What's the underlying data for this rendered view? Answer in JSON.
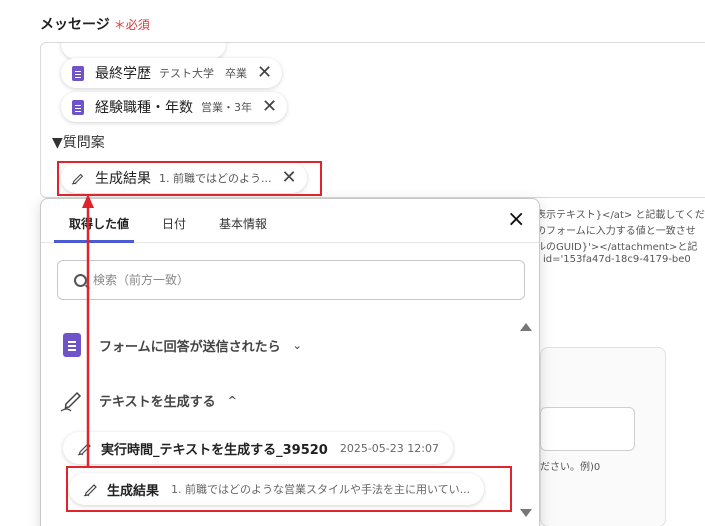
{
  "field": {
    "label": "メッセージ",
    "required_mark": "＊",
    "required_text": "必須"
  },
  "editor": {
    "chips": [
      {
        "name": "最終学歴",
        "value": "テスト大学　卒業"
      },
      {
        "name": "経験職種・年数",
        "value": "営業・3年"
      }
    ],
    "section_label": "▼質問案",
    "result_chip": {
      "name": "生成結果",
      "value": "1. 前職ではどのよう..."
    }
  },
  "background_text": [
    "表示テキスト}</at> と記載してくだ",
    "のフォームに入力する値と一致させ",
    "ルのGUID}'></attachment>と記",
    "id='153fa47d-18c9-4179-be0",
    "ださい。例)0"
  ],
  "popup": {
    "tabs": [
      "取得した値",
      "日付",
      "基本情報"
    ],
    "close": "×",
    "search_placeholder": "検索（前方一致）",
    "groups": [
      {
        "label": "フォームに回答が送信されたら",
        "chevron": "⌄"
      },
      {
        "label": "テキストを生成する",
        "chevron": "^"
      }
    ],
    "items": [
      {
        "name": "実行時間_テキストを生成する_39520",
        "value": "2025-05-23 12:07"
      },
      {
        "name": "生成結果",
        "value": "1. 前職ではどのような営業スタイルや手法を主に用いてい..."
      }
    ]
  },
  "colors": {
    "highlight": "#e0242b",
    "accent": "#4a5bd4",
    "form_icon": "#6e54c8",
    "required": "#e0333a"
  }
}
